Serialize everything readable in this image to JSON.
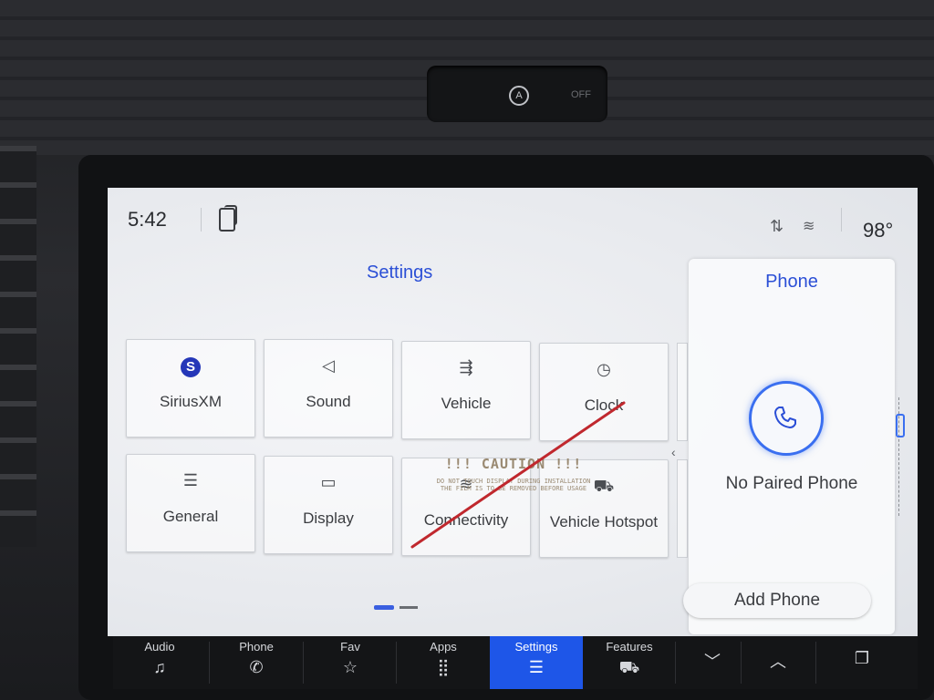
{
  "dashboard": {
    "button_label": "OFF",
    "button_icon": "a-circle-icon"
  },
  "status": {
    "time": "5:42",
    "temperature": "98°",
    "icons": [
      "phone-projection-icon",
      "data-transfer-icon",
      "wifi-icon"
    ]
  },
  "settings": {
    "title": "Settings",
    "tiles": [
      {
        "label": "SiriusXM",
        "icon": "siriusxm-icon",
        "glyph": "S"
      },
      {
        "label": "Sound",
        "icon": "speaker-icon",
        "glyph": "◁"
      },
      {
        "label": "Vehicle",
        "icon": "vehicle-settings-icon",
        "glyph": "⇶"
      },
      {
        "label": "Clock",
        "icon": "clock-icon",
        "glyph": "◷"
      },
      {
        "label": "General",
        "icon": "sliders-icon",
        "glyph": "☰"
      },
      {
        "label": "Display",
        "icon": "display-icon",
        "glyph": "▭"
      },
      {
        "label": "Connectivity",
        "icon": "wifi-icon",
        "glyph": "≋"
      },
      {
        "label": "Vehicle Hotspot",
        "icon": "truck-wifi-icon",
        "glyph": "⛟"
      }
    ],
    "caution": {
      "line1": "!!! CAUTION !!!",
      "line2": "DO NOT TOUCH DISPLAY DURING INSTALLATION",
      "line3": "THE FILM IS TO BE REMOVED BEFORE USAGE"
    }
  },
  "phone_panel": {
    "title": "Phone",
    "status": "No Paired Phone",
    "add_button": "Add Phone"
  },
  "nav": [
    {
      "label": "Audio",
      "icon": "music-note-icon",
      "glyph": "♫"
    },
    {
      "label": "Phone",
      "icon": "phone-icon",
      "glyph": "✆"
    },
    {
      "label": "Fav",
      "icon": "star-icon",
      "glyph": "☆"
    },
    {
      "label": "Apps",
      "icon": "apps-grid-icon",
      "glyph": "⣿"
    },
    {
      "label": "Settings",
      "icon": "settings-sliders-icon",
      "glyph": "☰",
      "active": true
    },
    {
      "label": "Features",
      "icon": "truck-icon",
      "glyph": "⛟"
    },
    {
      "label": "",
      "icon": "chevron-down-icon",
      "glyph": "﹀"
    },
    {
      "label": "",
      "icon": "chevron-up-icon",
      "glyph": "︿"
    },
    {
      "label": "",
      "icon": "overlapping-windows-icon",
      "glyph": "❐"
    }
  ],
  "colors": {
    "accent": "#2b4fd6",
    "active_nav": "#1e56e8",
    "caution_line": "#c0282e"
  }
}
